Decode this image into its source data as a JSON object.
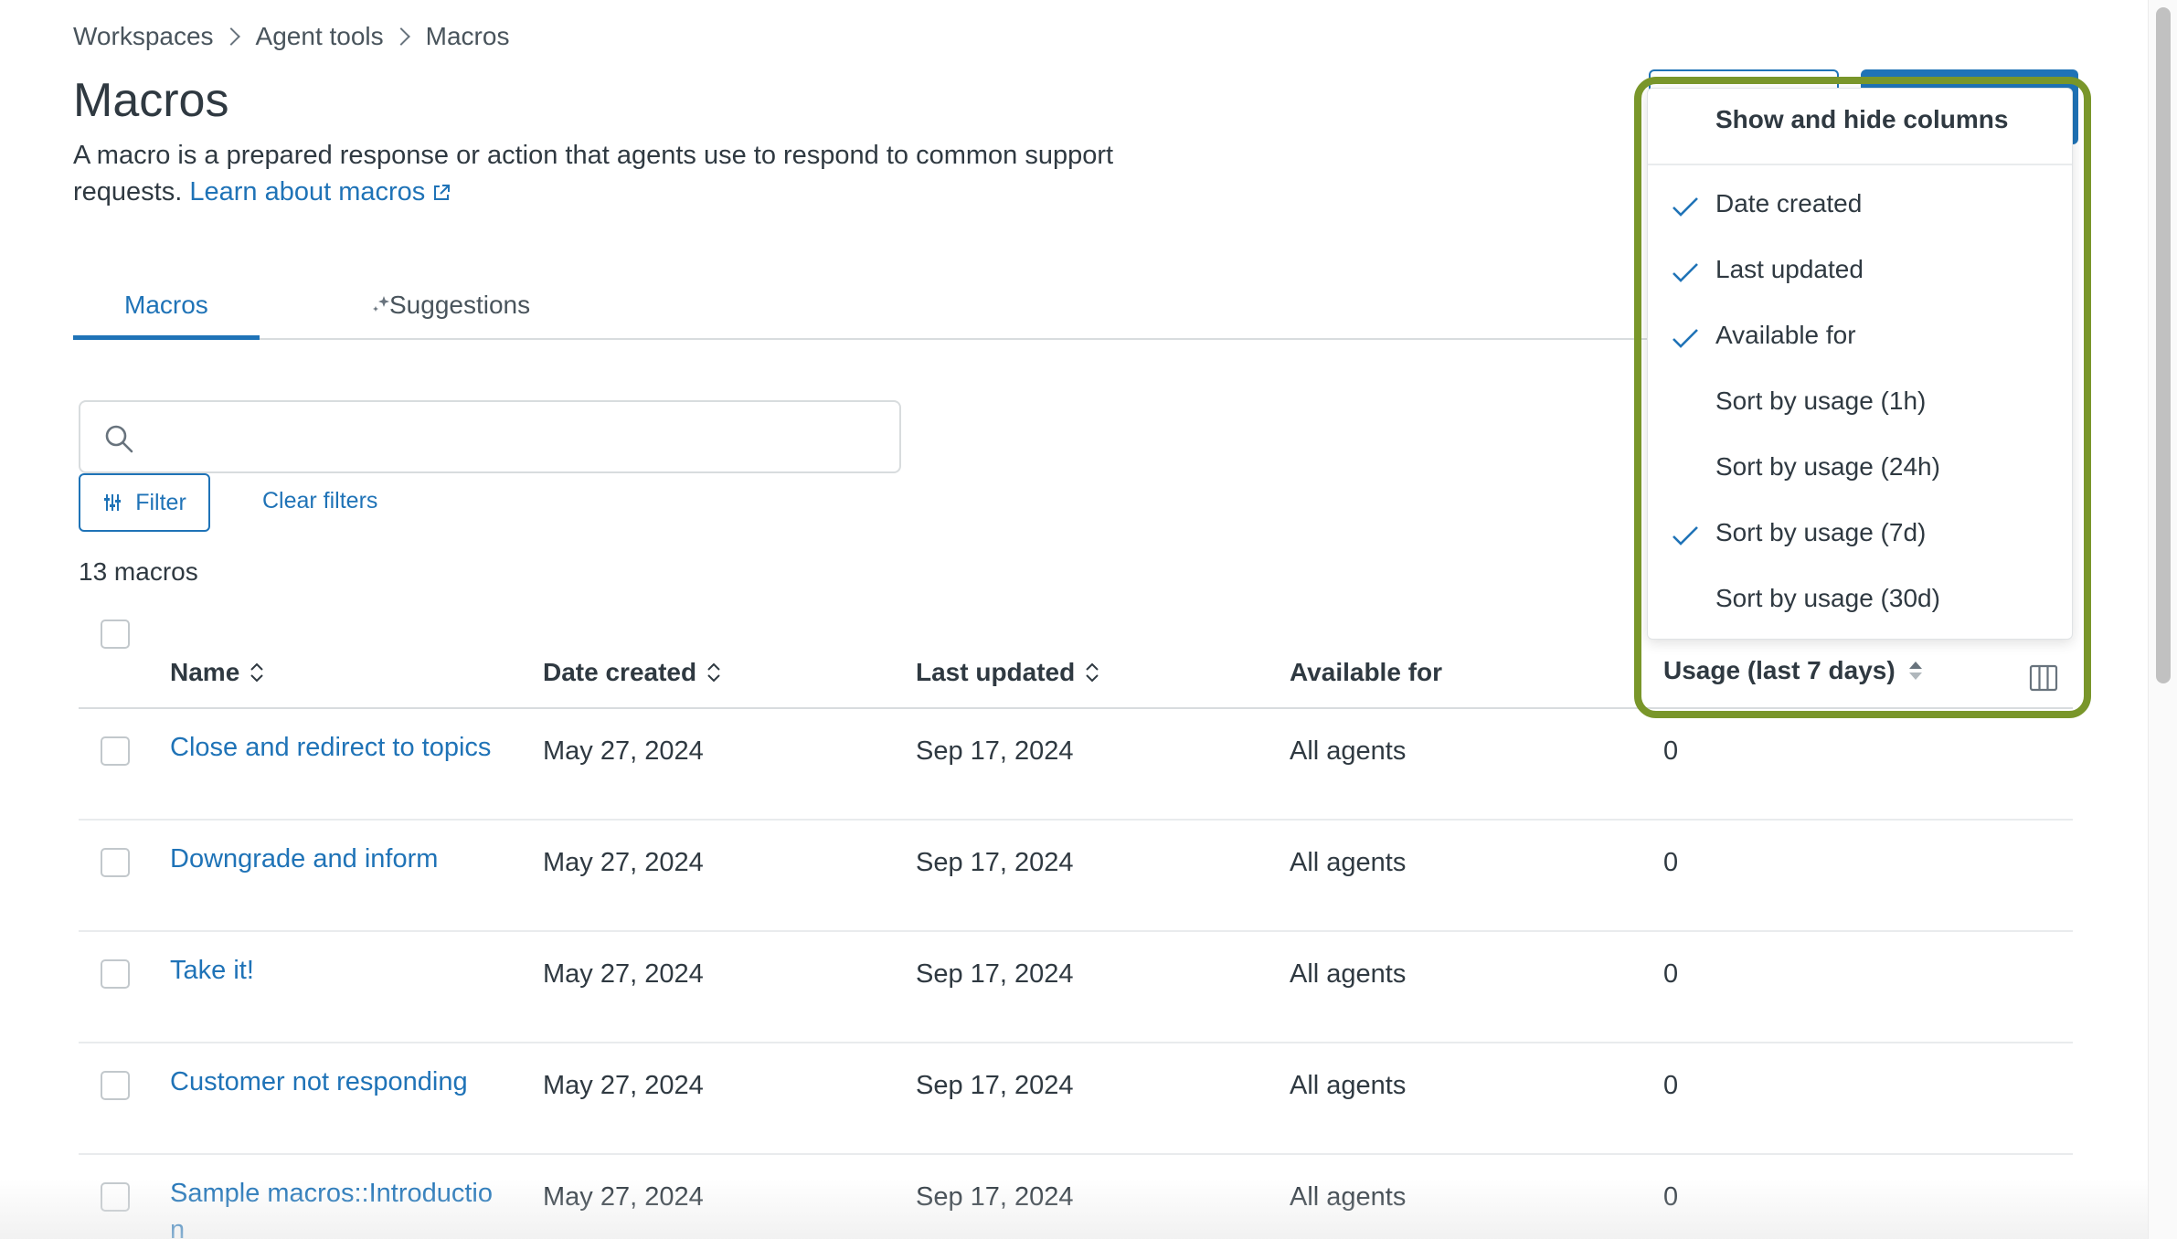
{
  "breadcrumb": [
    "Workspaces",
    "Agent tools",
    "Macros"
  ],
  "page": {
    "title": "Macros",
    "description": "A macro is a prepared response or action that agents use to respond to common support requests.",
    "learn_link": "Learn about macros"
  },
  "tabs": [
    "Macros",
    "Suggestions"
  ],
  "search": {
    "value": "",
    "placeholder": ""
  },
  "filter_label": "Filter",
  "clear_filters_label": "Clear filters",
  "count_text": "13 macros",
  "table": {
    "columns": [
      "Name",
      "Date created",
      "Last updated",
      "Available for",
      "Usage (last 7 days)"
    ],
    "rows": [
      {
        "name": "Close and redirect to topics",
        "created": "May 27, 2024",
        "updated": "Sep 17, 2024",
        "available": "All agents",
        "usage": "0"
      },
      {
        "name": "Downgrade and inform",
        "created": "May 27, 2024",
        "updated": "Sep 17, 2024",
        "available": "All agents",
        "usage": "0"
      },
      {
        "name": "Take it!",
        "created": "May 27, 2024",
        "updated": "Sep 17, 2024",
        "available": "All agents",
        "usage": "0"
      },
      {
        "name": "Customer not responding",
        "created": "May 27, 2024",
        "updated": "Sep 17, 2024",
        "available": "All agents",
        "usage": "0"
      },
      {
        "name": "Sample macros::Introductio n",
        "created": "May 27, 2024",
        "updated": "Sep 17, 2024",
        "available": "All agents",
        "usage": "0"
      }
    ]
  },
  "columns_menu": {
    "title": "Show and hide columns",
    "items": [
      {
        "label": "Date created",
        "checked": true
      },
      {
        "label": "Last updated",
        "checked": true
      },
      {
        "label": "Available for",
        "checked": true
      },
      {
        "label": "Sort by usage (1h)",
        "checked": false
      },
      {
        "label": "Sort by usage (24h)",
        "checked": false
      },
      {
        "label": "Sort by usage (7d)",
        "checked": true
      },
      {
        "label": "Sort by usage (30d)",
        "checked": false
      }
    ]
  },
  "colors": {
    "link": "#1f73b7",
    "highlight": "#79962a",
    "text": "#2f3941",
    "border": "#d8dcde"
  },
  "icons": [
    "chevron-right-icon",
    "external-link-icon",
    "sparkle-icon",
    "search-icon",
    "filter-icon",
    "sort-icon",
    "check-icon",
    "columns-icon"
  ]
}
